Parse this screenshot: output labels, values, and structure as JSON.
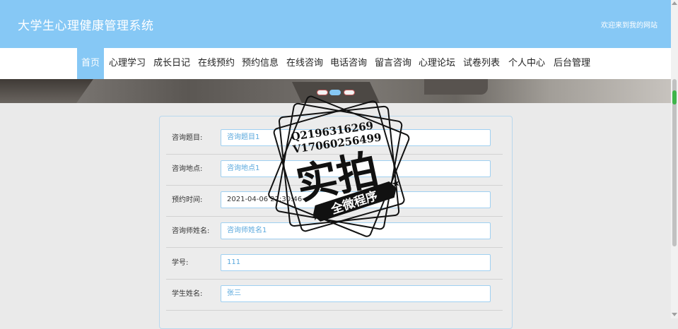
{
  "header": {
    "title": "大学生心理健康管理系统",
    "welcome": "欢迎来到我的网站"
  },
  "nav": {
    "items": [
      {
        "label": "首页",
        "active": true
      },
      {
        "label": "心理学习"
      },
      {
        "label": "成长日记"
      },
      {
        "label": "在线预约"
      },
      {
        "label": "预约信息"
      },
      {
        "label": "在线咨询"
      },
      {
        "label": "电话咨询"
      },
      {
        "label": "留言咨询"
      },
      {
        "label": "心理论坛"
      },
      {
        "label": "试卷列表"
      },
      {
        "label": "个人中心"
      },
      {
        "label": "后台管理"
      }
    ]
  },
  "form": {
    "fields": [
      {
        "label": "咨询题目:",
        "value": "咨询题目1"
      },
      {
        "label": "咨询地点:",
        "value": "咨询地点1"
      },
      {
        "label": "预约时间:",
        "value": "2021-04-06 22:30:46"
      },
      {
        "label": "咨询师姓名:",
        "value": "咨询师姓名1"
      },
      {
        "label": "学号:",
        "value": "111"
      },
      {
        "label": "学生姓名:",
        "value": "张三"
      }
    ]
  },
  "watermark": {
    "line1": "Q2196316269",
    "line2": "V17060256499",
    "main": "实拍",
    "ribbon": "全微程序"
  },
  "colors": {
    "accent": "#86c8f5",
    "input_border": "#9fd0f1"
  }
}
